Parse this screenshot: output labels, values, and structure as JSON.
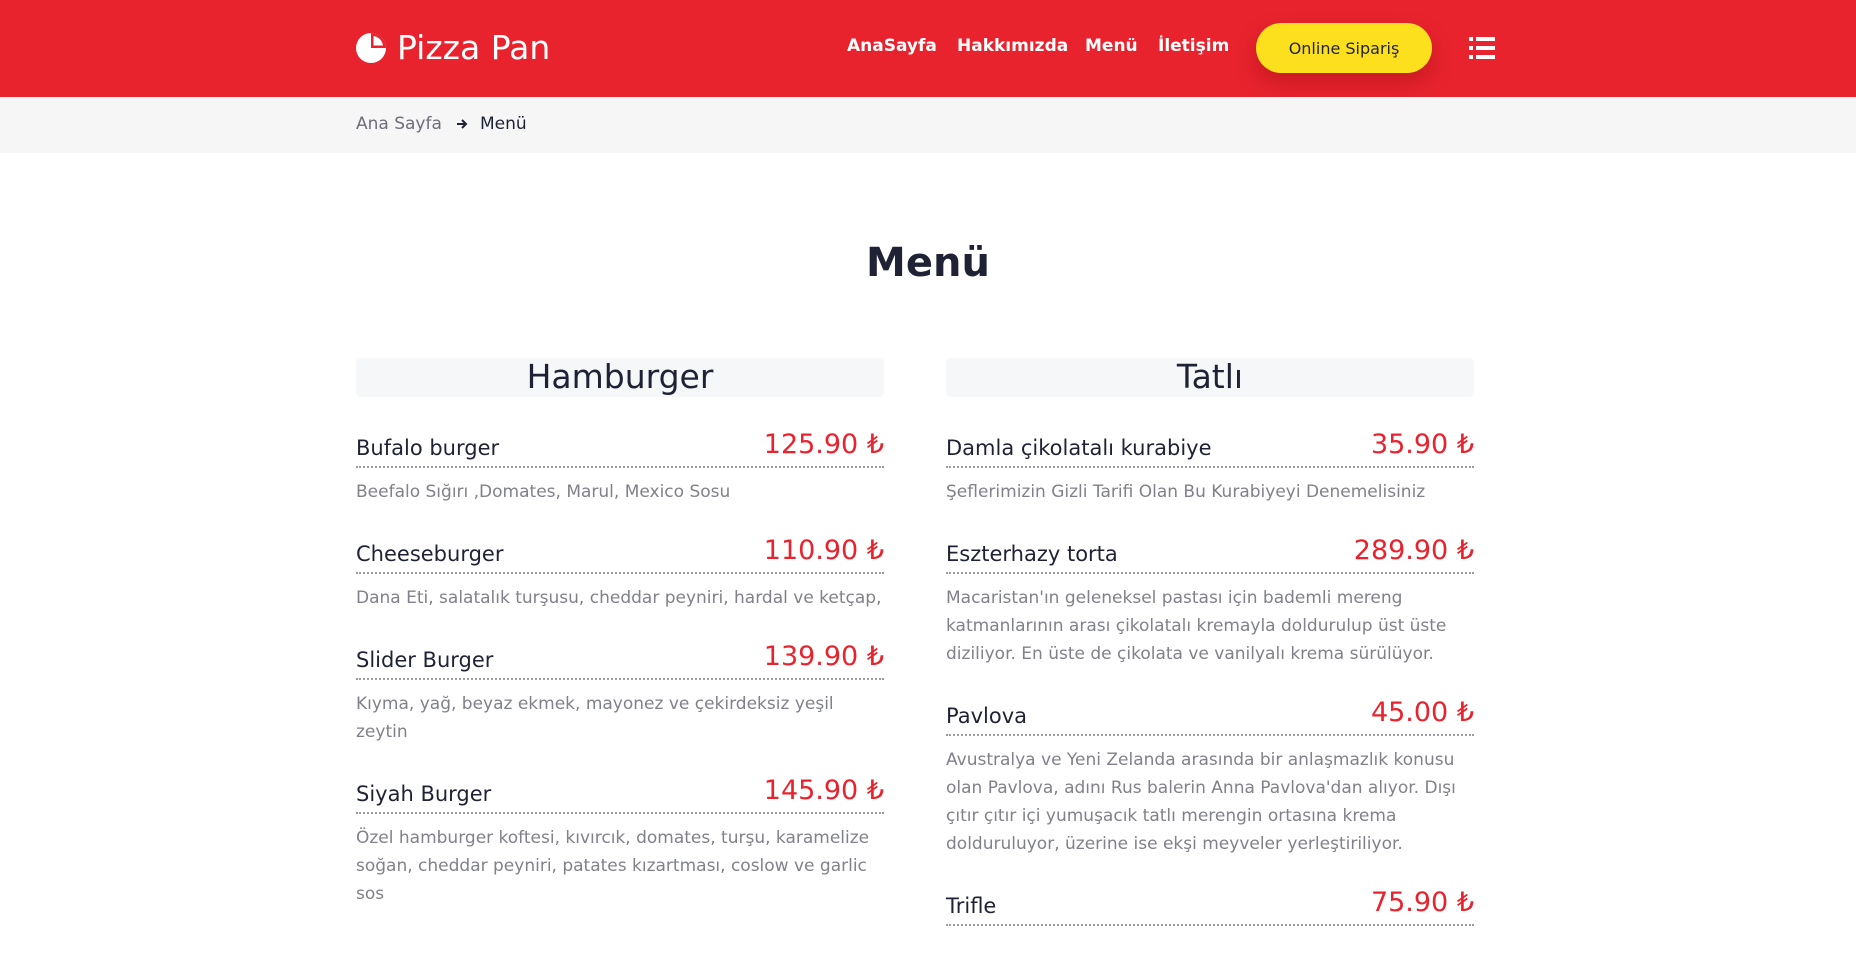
{
  "brand": {
    "name": "Pizza Pan"
  },
  "nav": {
    "items": [
      "AnaSayfa",
      "Hakkımızda",
      "Menü",
      "İletişim"
    ],
    "order_button": "Online Sipariş"
  },
  "breadcrumb": {
    "home": "Ana Sayfa",
    "current": "Menü"
  },
  "page_title": "Menü",
  "categories": [
    {
      "title": "Hamburger",
      "items": [
        {
          "name": "Bufalo burger",
          "price": "125.90 ₺",
          "desc": "Beefalo Sığırı ,Domates, Marul, Mexico Sosu"
        },
        {
          "name": "Cheeseburger",
          "price": "110.90 ₺",
          "desc": "Dana Eti, salatalık turşusu, cheddar peyniri, hardal ve ketçap,"
        },
        {
          "name": "Slider Burger",
          "price": "139.90 ₺",
          "desc": "Kıyma, yağ, beyaz ekmek, mayonez ve çekirdeksiz yeşil zeytin"
        },
        {
          "name": "Siyah Burger",
          "price": "145.90 ₺",
          "desc": "Özel hamburger koftesi, kıvırcık, domates, turşu, karamelize soğan, cheddar peyniri, patates kızartması, coslow ve garlic sos"
        }
      ]
    },
    {
      "title": "Tatlı",
      "items": [
        {
          "name": "Damla çikolatalı kurabiye",
          "price": "35.90 ₺",
          "desc": "Şeflerimizin Gizli Tarifi Olan Bu Kurabiyeyi Denemelisiniz"
        },
        {
          "name": "Eszterhazy torta",
          "price": "289.90 ₺",
          "desc": "Macaristan'ın geleneksel pastası için bademli mereng katmanlarının arası çikolatalı kremayla doldurulup üst üste diziliyor. En üste de çikolata ve vanilyalı krema sürülüyor."
        },
        {
          "name": "Pavlova",
          "price": "45.00 ₺",
          "desc": "Avustralya ve Yeni Zelanda arasında bir anlaşmazlık konusu olan Pavlova, adını Rus balerin Anna Pavlova'dan alıyor. Dışı çıtır çıtır içi yumuşacık tatlı merengin ortasına krema dolduruluyor, üzerine ise ekşi meyveler yerleştiriliyor."
        },
        {
          "name": "Trifle",
          "price": "75.90 ₺",
          "desc": ""
        }
      ]
    }
  ],
  "colors": {
    "primary": "#e8232e",
    "accent": "#fde01d",
    "text": "#1f2235",
    "muted": "#80818a"
  },
  "icons": {
    "logo": "pizza-slice-icon",
    "menu": "list-icon",
    "breadcrumb": "arrow-right-icon"
  }
}
